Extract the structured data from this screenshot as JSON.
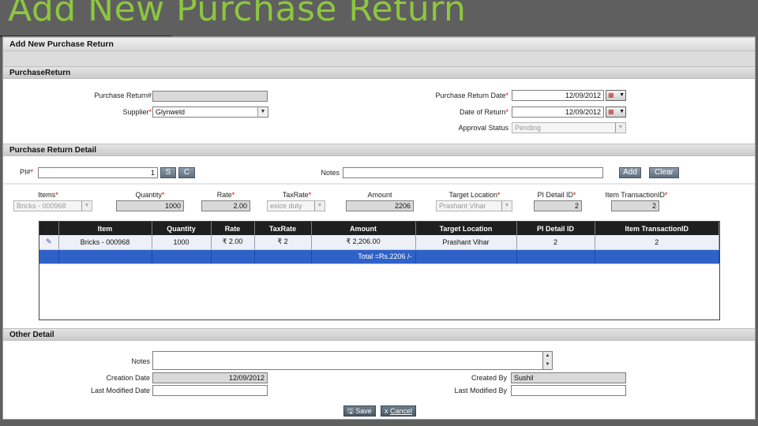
{
  "slide": {
    "title": "Add New Purchase Return"
  },
  "page": {
    "heading": "Add New Purchase Return"
  },
  "sections": {
    "purchase_return": "PurchaseReturn",
    "detail": "Purchase Return Detail",
    "other": "Other Detail"
  },
  "header_form": {
    "purchase_return_no": {
      "label": "Purchase Return#",
      "value": ""
    },
    "supplier": {
      "label": "Supplier",
      "value": "Glynweld"
    },
    "purchase_return_date": {
      "label": "Purchase Return Date",
      "value": "12/09/2012"
    },
    "date_of_return": {
      "label": "Date of Return",
      "value": "12/09/2012"
    },
    "approval_status": {
      "label": "Approval Status",
      "value": "Pending"
    }
  },
  "detail_form": {
    "pi": {
      "label": "PI#",
      "value": "1",
      "s_label": "S",
      "c_label": "C"
    },
    "notes": {
      "label": "Notes",
      "value": ""
    },
    "add_label": "Add",
    "clear_label": "Clear"
  },
  "line_entry": {
    "items": {
      "label": "Items",
      "value": "Bricks - 000968"
    },
    "quantity": {
      "label": "Quantity",
      "value": "1000"
    },
    "rate": {
      "label": "Rate",
      "value": "2.00"
    },
    "tax_rate": {
      "label": "TaxRate",
      "value": "exice duty"
    },
    "amount": {
      "label": "Amount",
      "value": "2206"
    },
    "target_location": {
      "label": "Target Location",
      "value": "Prashant Vihar"
    },
    "pi_detail_id": {
      "label": "PI Detail ID",
      "value": "2"
    },
    "item_transaction_id": {
      "label": "Item TransactionID",
      "value": "2"
    }
  },
  "grid": {
    "columns": [
      "",
      "Item",
      "Quantity",
      "Rate",
      "TaxRate",
      "Amount",
      "Target Location",
      "PI Detail ID",
      "Item TransactionID"
    ],
    "rows": [
      {
        "icon": "edit-icon",
        "item": "Bricks - 000968",
        "quantity": "1000",
        "rate": "₹ 2.00",
        "tax_rate": "₹ 2",
        "amount": "₹ 2,206.00",
        "target_location": "Prashant Vihar",
        "pi_detail_id": "2",
        "item_transaction_id": "2"
      }
    ],
    "total": "Total =Rs.2206 /-"
  },
  "other_detail": {
    "notes": {
      "label": "Notes",
      "value": ""
    },
    "creation_date": {
      "label": "Creation Date",
      "value": "12/09/2012"
    },
    "last_modified_date": {
      "label": "Last Modified Date",
      "value": ""
    },
    "created_by": {
      "label": "Created By",
      "value": "Sushil"
    },
    "last_modified_by": {
      "label": "Last Modified By",
      "value": ""
    }
  },
  "actions": {
    "save_label": "Save",
    "cancel_label": "Cancel"
  },
  "colors": {
    "slide_title": "#8dc63f",
    "grid_header": "#1f1f1f",
    "total_row": "#2e62c8"
  }
}
